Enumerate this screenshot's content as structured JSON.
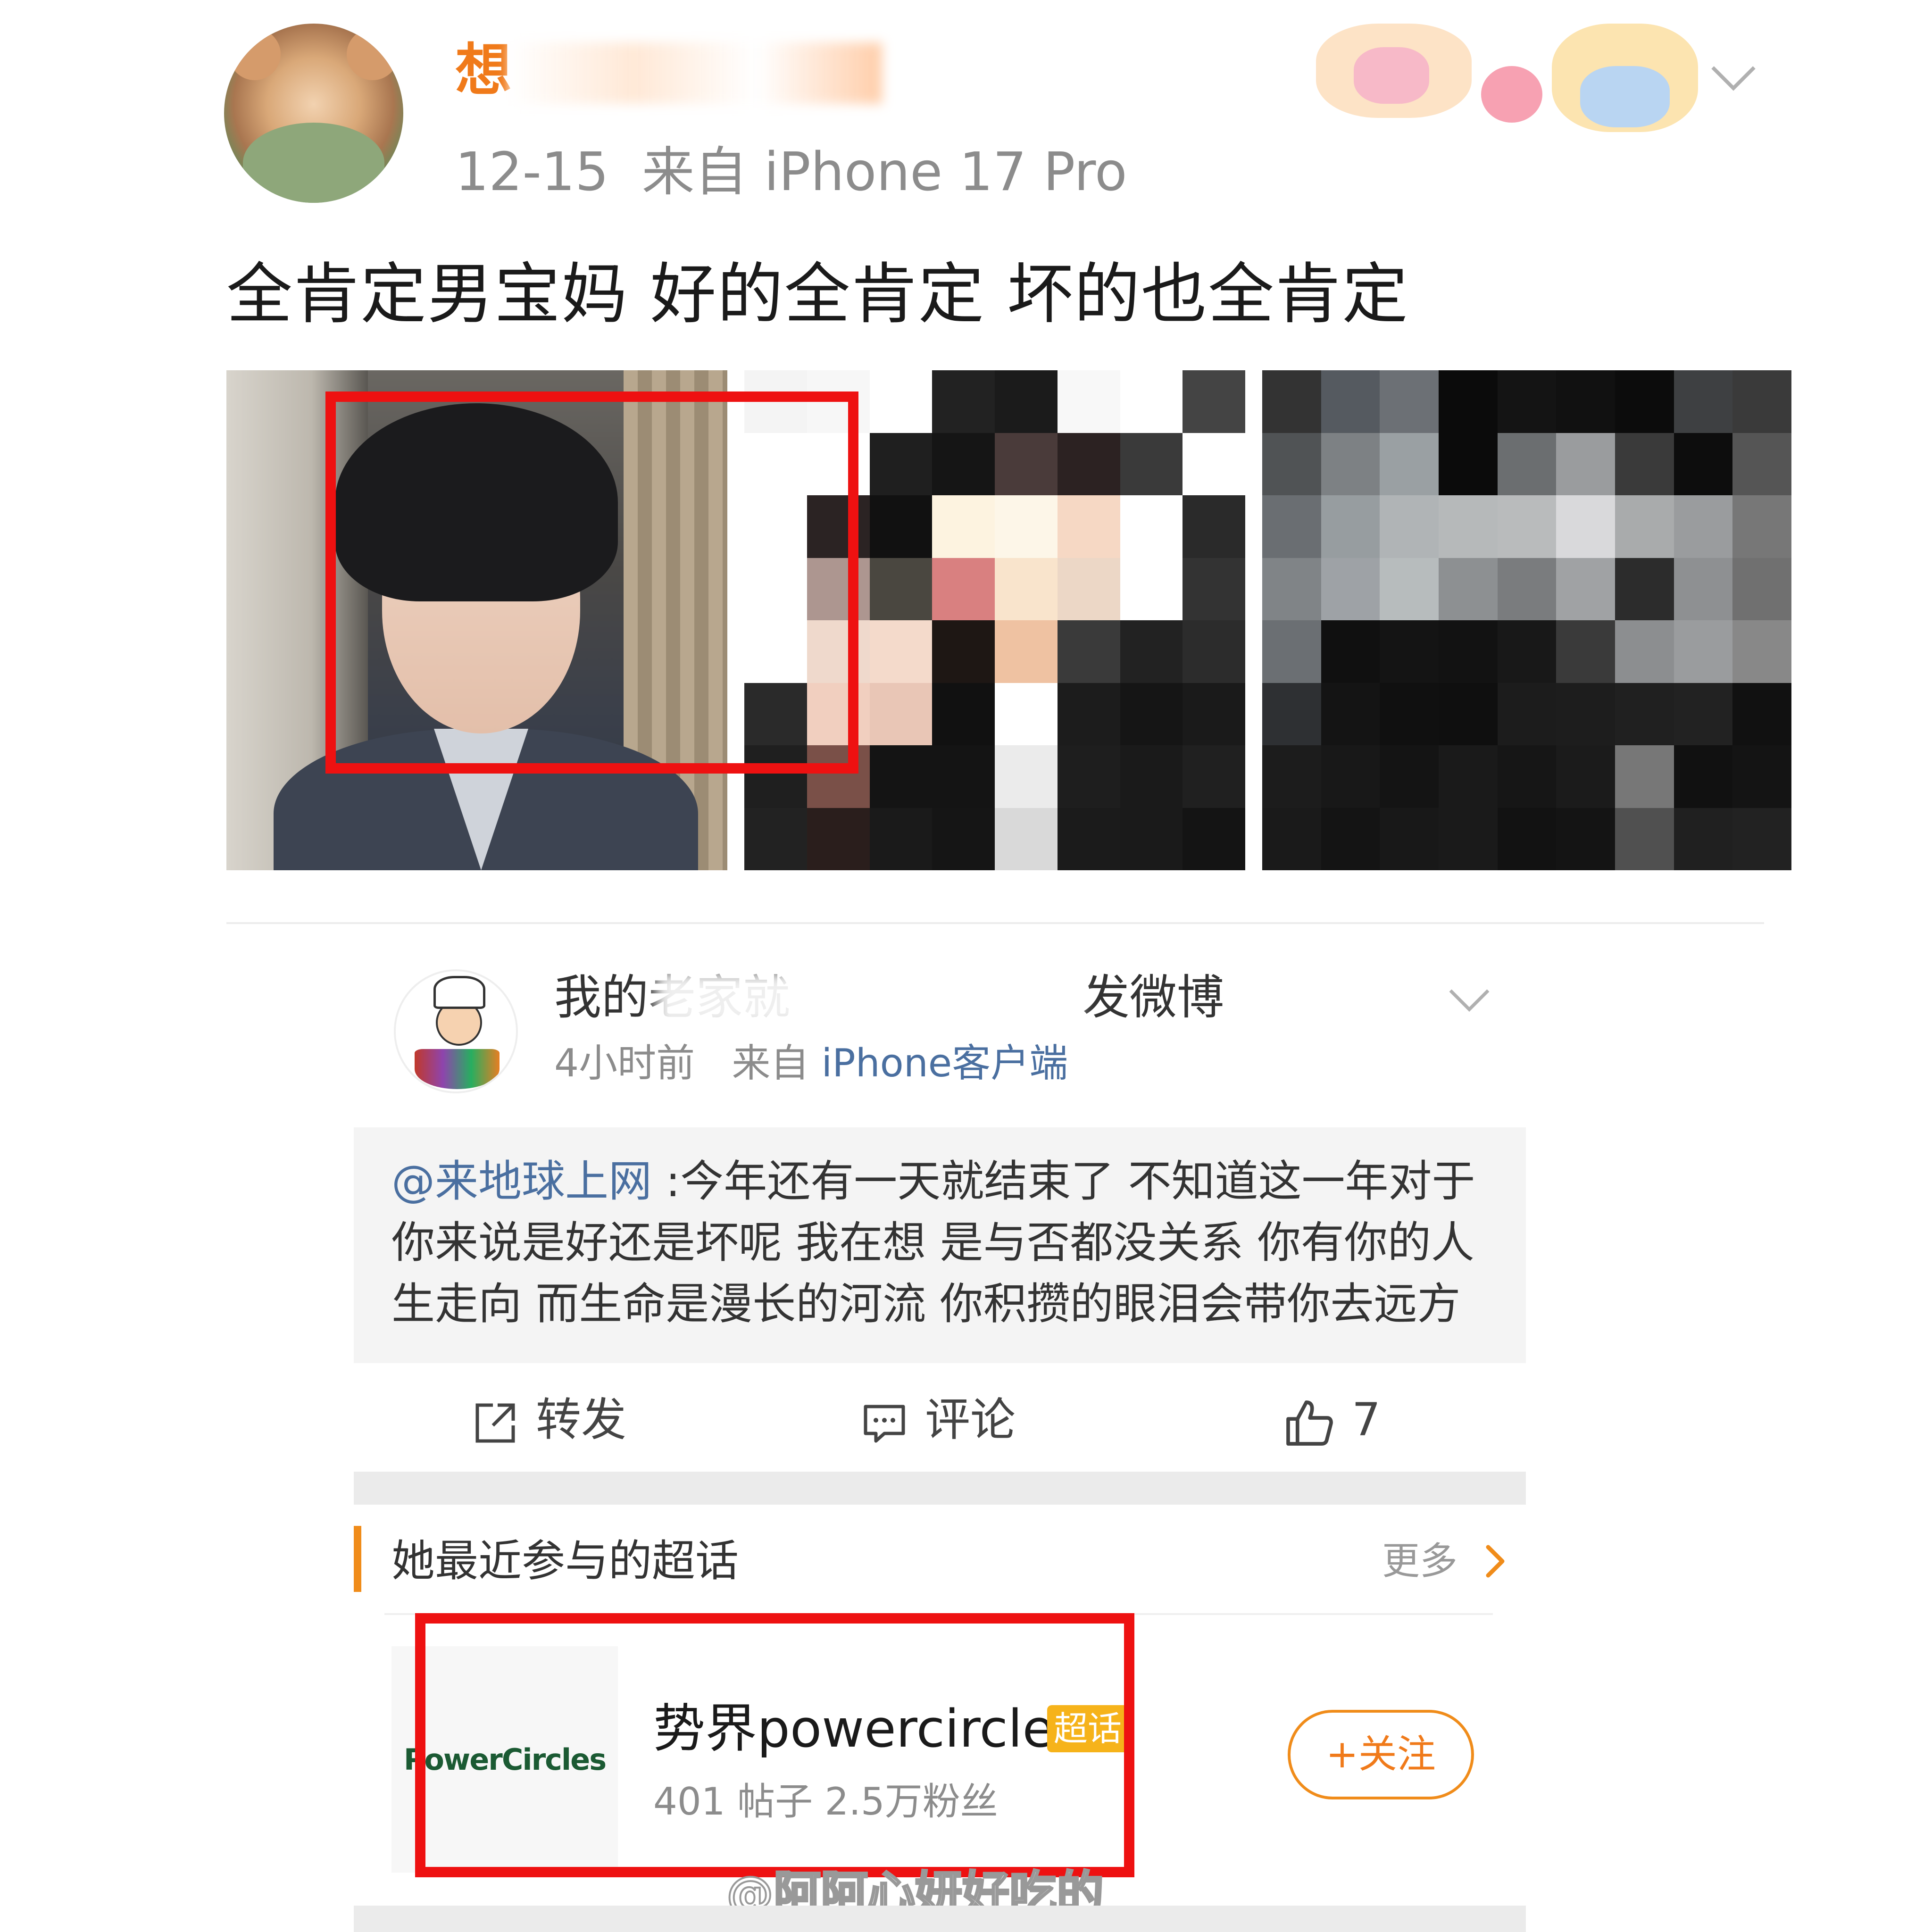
{
  "post": {
    "username": "想",
    "date": "12-15",
    "source": "来自 iPhone 17 Pro",
    "text": "全肯定男宝妈 好的全肯定 坏的也全肯定"
  },
  "repost": {
    "username": "我的老家就",
    "username_suffix": "发微博",
    "time": "4小时前",
    "source_prefix": "来自",
    "source": "iPhone客户端",
    "mention": "@来地球上网",
    "quote": " :今年还有一天就结束了 不知道这一年对于你来说是好还是坏呢 我在想 是与否都没关系 你有你的人生走向 而生命是漫长的河流 你积攒的眼泪会带你去远方"
  },
  "actions": {
    "repost_label": "转发",
    "comment_label": "评论",
    "like_count": "7"
  },
  "supertopic": {
    "section_title": "她最近参与的超话",
    "more_label": "更多",
    "logo_text": "PowerCircles",
    "name": "势界powercircles",
    "badge": "超话",
    "stats": "401 帖子 2.5万粉丝",
    "follow_label": "+关注"
  },
  "watermark": "@阿阿心妍好吃的",
  "colors": {
    "accent_orange": "#f08c1a",
    "link_blue": "#4a6fa0",
    "highlight_red": "#ee1111"
  },
  "pixel_colors_photo2": [
    "#f4f4f4",
    "#f7f7f7",
    "#ffffff",
    "#222222",
    "#1b1b1b",
    "#f8f8f8",
    "#ffffff",
    "#444444",
    "#ffffff",
    "#ffffff",
    "#1f1f1f",
    "#151515",
    "#4a3b3a",
    "#2c2222",
    "#3a3a3a",
    "#ffffff",
    "#ffffff",
    "#2b2323",
    "#111111",
    "#fdf3e0",
    "#fdf6e8",
    "#f6d8c4",
    "#ffffff",
    "#2a2a2a",
    "#ffffff",
    "#ad9690",
    "#4a4740",
    "#d98080",
    "#f9e4cc",
    "#ecd7c6",
    "#ffffff",
    "#333333",
    "#ffffff",
    "#efd9cc",
    "#f4dacb",
    "#1e1714",
    "#efc2a2",
    "#3a3a3a",
    "#222222",
    "#2c2c2c",
    "#2a2a2a",
    "#f1cfbf",
    "#e9c6b6",
    "#111111",
    "#ffffff",
    "#1c1c1c",
    "#151515",
    "#1a1a1a",
    "#1f1f1f",
    "#7a5048",
    "#141414",
    "#141414",
    "#ebebeb",
    "#1e1e1e",
    "#1a1a1a",
    "#202020",
    "#222222",
    "#2a1e1c",
    "#1a1a1a",
    "#151515",
    "#d9d9d9",
    "#1b1b1b",
    "#1a1a1a",
    "#141414"
  ],
  "pixel_colors_photo3": [
    "#333333",
    "#555a60",
    "#6c7075",
    "#0b0b0b",
    "#141414",
    "#111111",
    "#0c0c0c",
    "#3e4042",
    "#3a3a3a",
    "#505355",
    "#7d8184",
    "#9aa0a3",
    "#0b0b0b",
    "#6b6e70",
    "#9a9c9e",
    "#3a3a3a",
    "#0d0d0d",
    "#555555",
    "#6a6e72",
    "#979da0",
    "#b0b4b6",
    "#b6b9ba",
    "#b9bbbc",
    "#d9d9db",
    "#a9abac",
    "#9a9c9e",
    "#777777",
    "#808487",
    "#9ea2a6",
    "#b7bcbd",
    "#8d9092",
    "#7a7c7e",
    "#a0a2a4",
    "#2c2c2c",
    "#8e9092",
    "#707070",
    "#6b6f73",
    "#101010",
    "#141414",
    "#121212",
    "#181818",
    "#3a3a3a",
    "#8c8e90",
    "#9a9c9e",
    "#888888",
    "#2e3033",
    "#141414",
    "#101010",
    "#0f0f0f",
    "#1c1c1c",
    "#1d1d1d",
    "#202020",
    "#222222",
    "#111111",
    "#1c1c1c",
    "#181818",
    "#141414",
    "#1a1a1a",
    "#161616",
    "#1b1b1b",
    "#777777",
    "#111111",
    "#141414",
    "#1a1a1a",
    "#141414",
    "#181818",
    "#1a1a1a",
    "#121212",
    "#141414",
    "#505050",
    "#202020",
    "#222222"
  ]
}
